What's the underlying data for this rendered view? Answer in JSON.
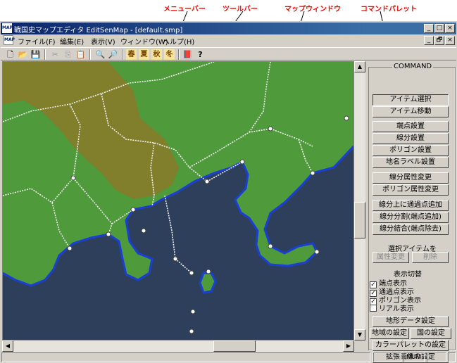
{
  "callouts": [
    "メニューバー",
    "ツールバー",
    "マップウィンドウ",
    "コマンドパレット"
  ],
  "app": {
    "icon_text": "MAP",
    "title": "戦国史マップエディタ EditSenMap - [default.smp]",
    "window_buttons": [
      "_",
      "□",
      "×"
    ],
    "mdi_buttons": [
      "_",
      "🗗",
      "×"
    ]
  },
  "menu": [
    "ファイル(F)",
    "編集(E)",
    "表示(V)",
    "ウィンドウ(W)",
    "ヘルプ(H)"
  ],
  "toolbar": {
    "icons": [
      "new-file-icon",
      "open-folder-icon",
      "save-icon",
      "cut-icon",
      "copy-icon",
      "paste-icon",
      "zoom-in-icon",
      "zoom-out-icon",
      "season-spring-icon",
      "season-summer-icon",
      "season-autumn-icon",
      "season-winter-icon",
      "book-icon",
      "help-icon"
    ],
    "glyphs": [
      "🗋",
      "📂",
      "💾",
      "✂",
      "⎘",
      "📋",
      "🔍",
      "🔎",
      "春",
      "夏",
      "秋",
      "冬",
      "📕",
      "?"
    ]
  },
  "map": {
    "sea_color": "#2e3f5c",
    "land_color": "#4f9a3a",
    "mountain_color": "#8a7a2a",
    "coast_color": "#1a3fd6",
    "border_color": "#f0f0f0"
  },
  "panel": {
    "title": "COMMAND",
    "groups": [
      [
        "アイテム選択",
        "アイテム移動"
      ],
      [
        "端点設置",
        "線分設置",
        "ポリゴン設置",
        "地名ラベル設置"
      ],
      [
        "線分属性変更",
        "ポリゴン属性変更"
      ],
      [
        "線分上に通過点追加",
        "線分分割(端点追加)",
        "線分結合(端点除去)"
      ]
    ],
    "selected_item_title": "選択アイテムを",
    "selected_item_buttons": [
      "属性変更",
      "削除"
    ],
    "display_title": "表示切替",
    "display_options": [
      {
        "label": "端点表示",
        "checked": true
      },
      {
        "label": "通過点表示",
        "checked": true
      },
      {
        "label": "ポリゴン表示",
        "checked": true
      },
      {
        "label": "リアル表示",
        "checked": false
      }
    ],
    "settings_buttons": [
      "地形データ設定",
      "地域の設定",
      "国の設定",
      "カラーパレットの設定",
      "拡張画像の設定"
    ]
  },
  "status": {
    "num": "NUM"
  }
}
